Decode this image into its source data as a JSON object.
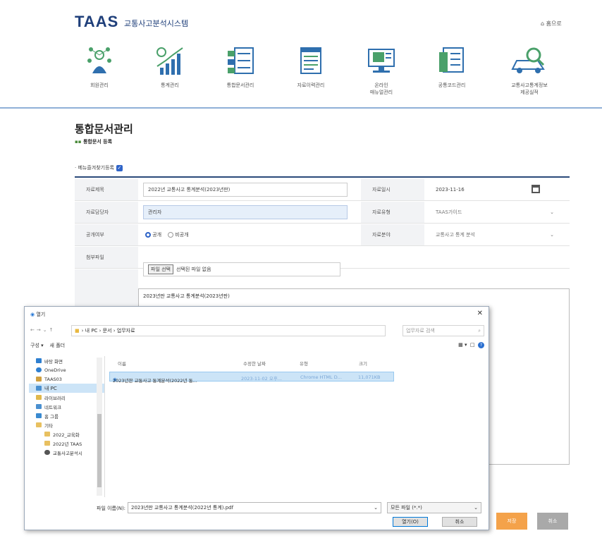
{
  "header": {
    "logo": "TAAS",
    "logo_accent_color": "#2fa0d8",
    "system_name": "교통사고분석시스템",
    "home_label": "홈으로"
  },
  "nav": [
    {
      "label": "회원관리",
      "icon": "member-network-icon"
    },
    {
      "label": "통계관리",
      "icon": "statistics-chart-icon"
    },
    {
      "label": "통합문서관리",
      "icon": "document-list-icon"
    },
    {
      "label": "자료이력관리",
      "icon": "history-document-icon"
    },
    {
      "label": "온라인\n매뉴얼관리",
      "icon": "monitor-manual-icon"
    },
    {
      "label": "공통코드관리",
      "icon": "code-list-icon"
    },
    {
      "label": "교통사고통계정보\n제공실적",
      "icon": "car-search-icon"
    }
  ],
  "page": {
    "title": "통합문서관리",
    "breadcrumb": "통합문서 등록",
    "favorite_label": "메뉴즐겨찾기등록"
  },
  "form": {
    "title_label": "자료제목",
    "title_value": "2022년 교통사고 통계분석(2023년판)",
    "date_label": "자료일시",
    "date_value": "2023-11-16",
    "author_label": "자료담당자",
    "author_value": "관리자",
    "type_label": "자료유형",
    "type_value": "TAAS가이드",
    "public_label": "공개여부",
    "public_yes": "공개",
    "public_no": "비공개",
    "category_label": "자료분야",
    "category_value": "교통사고 통계 분석",
    "file_label": "첨부파일",
    "file_button": "파일 선택",
    "file_status": "선택된 파일 없음",
    "content_value": "2023년판 교통사고 통계분석(2023년판)"
  },
  "buttons": {
    "save": "저장",
    "cancel": "취소"
  },
  "dialog": {
    "title": "열기",
    "address": "› 내 PC › 문서 › 업무자료",
    "search_placeholder": "업무자료 검색",
    "organize": "구성 ▾",
    "new_folder": "새 폴더",
    "tree": [
      {
        "label": "바탕 화면",
        "color": "#2f7fd0"
      },
      {
        "label": "OneDrive",
        "color": "#2f7fd0"
      },
      {
        "label": "TAAS03",
        "color": "#d0a040"
      },
      {
        "label": "내 PC",
        "color": "#4a90d0",
        "selected": true
      },
      {
        "label": "라이브러리",
        "color": "#e0b84c"
      },
      {
        "label": "네트워크",
        "color": "#4a90d0"
      },
      {
        "label": "홈 그룹",
        "color": "#3a8ad0"
      },
      {
        "label": "기타",
        "color": "#e8c060"
      },
      {
        "label": "2022_교육화",
        "color": "#e8c060",
        "indent": true
      },
      {
        "label": "2022년 TAAS",
        "color": "#e8c060",
        "indent": true
      },
      {
        "label": "교통사고분석시",
        "color": "#555555",
        "indent": true
      }
    ],
    "columns": [
      "이름",
      "수정한 날짜",
      "유형",
      "크기"
    ],
    "file": {
      "name": "2023년판 교통사고 통계분석(2022년 통...",
      "date": "2023-11-02 오후...",
      "type": "Chrome HTML D...",
      "size": "11,071KB"
    },
    "filename_label": "파일 이름(N):",
    "filename_value": "2023년판 교통사고 통계분석(2022년 통계).pdf",
    "filetype": "모든 파일 (*.*)",
    "open": "열기(O)",
    "cancel": "취소"
  }
}
